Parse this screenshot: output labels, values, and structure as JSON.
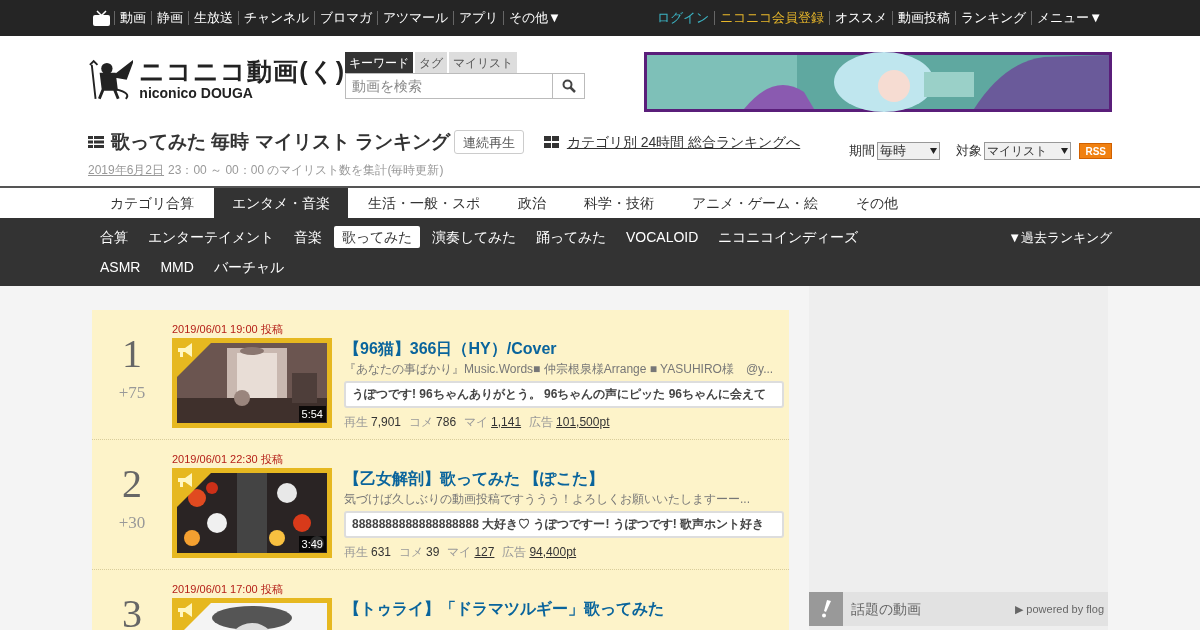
{
  "top_nav": {
    "items": [
      "動画",
      "静画",
      "生放送",
      "チャンネル",
      "ブロマガ",
      "アツマール",
      "アプリ",
      "その他▼"
    ],
    "right_items": [
      {
        "label": "ログイン",
        "kind": "login"
      },
      {
        "label": "ニコニコ会員登録",
        "kind": "register"
      },
      {
        "label": "オススメ",
        "kind": "normal"
      },
      {
        "label": "動画投稿",
        "kind": "normal"
      },
      {
        "label": "ランキング",
        "kind": "normal"
      },
      {
        "label": "メニュー▼",
        "kind": "normal"
      }
    ]
  },
  "logo": {
    "title": "ニコニコ動画(く)",
    "subtitle": "niconico DOUGA"
  },
  "search": {
    "tabs": [
      {
        "label": "キーワード",
        "selected": true
      },
      {
        "label": "タグ",
        "selected": false
      },
      {
        "label": "マイリスト",
        "selected": false
      }
    ],
    "placeholder": "動画を検索"
  },
  "heading": {
    "title": "歌ってみた 毎時 マイリスト ランキング",
    "play_all": "連続再生",
    "category_link": "カテゴリ別 24時間 総合ランキングへ",
    "date_link": "2019年6月2日",
    "period_text": "23：00 ～ 00：00 のマイリスト数を集計(毎時更新)"
  },
  "filters": {
    "period_label": "期間",
    "period_value": "毎時",
    "target_label": "対象",
    "target_value": "マイリスト",
    "rss": "RSS"
  },
  "category_tabs": [
    {
      "label": "カテゴリ合算",
      "selected": false
    },
    {
      "label": "エンタメ・音楽",
      "selected": true
    },
    {
      "label": "生活・一般・スポ",
      "selected": false
    },
    {
      "label": "政治",
      "selected": false
    },
    {
      "label": "科学・技術",
      "selected": false
    },
    {
      "label": "アニメ・ゲーム・絵",
      "selected": false
    },
    {
      "label": "その他",
      "selected": false
    }
  ],
  "genres": [
    {
      "label": "合算",
      "selected": false
    },
    {
      "label": "エンターテイメント",
      "selected": false
    },
    {
      "label": "音楽",
      "selected": false
    },
    {
      "label": "歌ってみた",
      "selected": true
    },
    {
      "label": "演奏してみた",
      "selected": false
    },
    {
      "label": "踊ってみた",
      "selected": false
    },
    {
      "label": "VOCALOID",
      "selected": false
    },
    {
      "label": "ニコニコインディーズ",
      "selected": false
    },
    {
      "label": "ASMR",
      "selected": false
    },
    {
      "label": "MMD",
      "selected": false
    },
    {
      "label": "バーチャル",
      "selected": false
    }
  ],
  "past_ranking": "▼過去ランキング",
  "rankings": [
    {
      "rank": "1",
      "change": "+75",
      "posted": "2019/06/01 19:00 投稿",
      "title": "【96猫】366日（HY）/Cover",
      "description": "『あなたの事ばかり』Music.Words■ 仲宗根泉様Arrange ■ YASUHIRO様　@y...",
      "comment": "うぽつです! 96ちゃんありがとう。 96ちゃんの声にピッた 96ちゃんに会えて",
      "duration": "5:54",
      "stats": {
        "views_label": "再生",
        "views": "7,901",
        "comments_label": "コメ",
        "comments": "786",
        "mylist_label": "マイ",
        "mylist": "1,141",
        "ad_label": "広告",
        "ad": "101,500pt"
      }
    },
    {
      "rank": "2",
      "change": "+30",
      "posted": "2019/06/01 22:30 投稿",
      "title": "【乙女解剖】歌ってみた 【ぽこた】",
      "description": "気づけば久しぶりの動画投稿ですううう！よろしくお願いいたしますーー...",
      "comment": "8888888888888888888 大好き♡ うぽつですー! うぽつです! 歌声ホント好き",
      "duration": "3:49",
      "stats": {
        "views_label": "再生",
        "views": "631",
        "comments_label": "コメ",
        "comments": "39",
        "mylist_label": "マイ",
        "mylist": "127",
        "ad_label": "広告",
        "ad": "94,400pt"
      }
    },
    {
      "rank": "3",
      "posted": "2019/06/01 17:00 投稿",
      "title": "【トゥライ】「ドラマツルギー」歌ってみた"
    }
  ],
  "side_panel": {
    "title": "話題の動画",
    "powered": "▶ powered by flog"
  }
}
